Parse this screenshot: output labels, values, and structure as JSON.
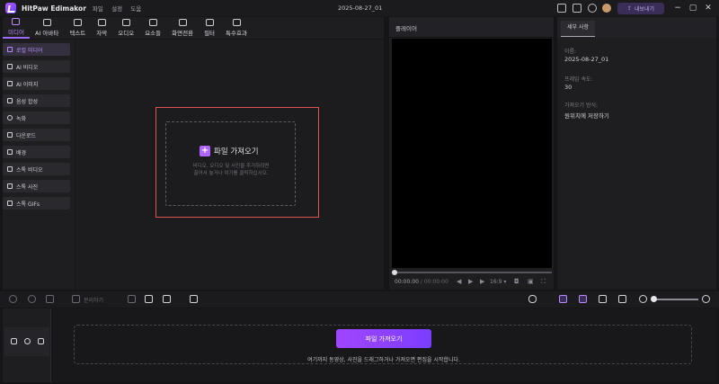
{
  "app": {
    "name": "HitPaw Edimakor",
    "menu": [
      "파일",
      "설정",
      "도움"
    ],
    "project_name": "2025-08-27_01",
    "export_label": "내보내기"
  },
  "toolbar": {
    "items": [
      {
        "label": "미디어",
        "icon": "media-icon",
        "active": true
      },
      {
        "label": "AI 아바타",
        "icon": "avatar-icon",
        "active": false
      },
      {
        "label": "텍스트",
        "icon": "text-icon",
        "active": false
      },
      {
        "label": "자막",
        "icon": "subtitle-icon",
        "active": false
      },
      {
        "label": "오디오",
        "icon": "audio-icon",
        "active": false
      },
      {
        "label": "요소들",
        "icon": "elements-icon",
        "active": false
      },
      {
        "label": "화면전환",
        "icon": "transition-icon",
        "active": false
      },
      {
        "label": "필터",
        "icon": "filter-icon",
        "active": false
      },
      {
        "label": "특수효과",
        "icon": "effects-icon",
        "active": false
      }
    ]
  },
  "sidebar": {
    "items": [
      {
        "label": "로컬 미디어",
        "active": true
      },
      {
        "label": "AI 비디오",
        "active": false
      },
      {
        "label": "AI 이미지",
        "active": false
      },
      {
        "label": "음성 합성",
        "active": false
      },
      {
        "label": "녹화",
        "active": false
      },
      {
        "label": "다운로드",
        "active": false
      },
      {
        "label": "배경",
        "active": false
      },
      {
        "label": "스톡 비디오",
        "active": false
      },
      {
        "label": "스톡 사진",
        "active": false
      },
      {
        "label": "스톡 GIFs",
        "active": false
      }
    ]
  },
  "media": {
    "import_label": "파일 가져오기",
    "hint_line1": "비디오, 오디오 및 사진을 추가하려면",
    "hint_line2": "끌어서 놓거나 여기를 클릭하십시오."
  },
  "player": {
    "tab_label": "플레이어",
    "current_time": "00:00:00",
    "separator": "/",
    "total_time": "00:00:00",
    "aspect_ratio": "16:9"
  },
  "details": {
    "tab_label": "세부 사항",
    "fields": [
      {
        "label": "이름:",
        "value": "2025-08-27_01"
      },
      {
        "label": "프레임 속도:",
        "value": "30"
      },
      {
        "label": "가져오기 방식:",
        "value": "원위치에 저장하기"
      }
    ]
  },
  "timeline": {
    "split_label": "분리하기",
    "import_label": "파일 가져오기",
    "hint": "여기까지 동영상, 사진을 드래그하거나 가져오면 편집을 시작합니다."
  },
  "colors": {
    "accent": "#9b6bff",
    "highlight_border": "#e0524a",
    "background": "#151517"
  }
}
